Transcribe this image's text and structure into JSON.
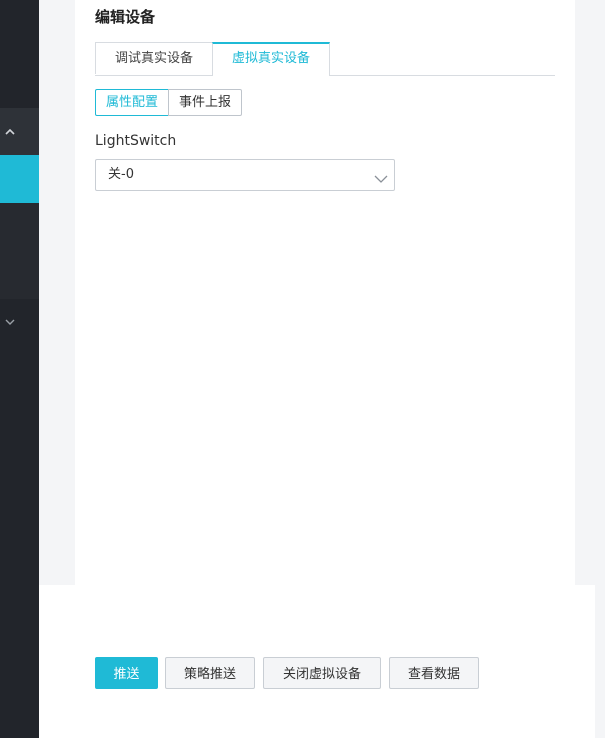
{
  "dialog": {
    "title": "编辑设备",
    "tabs": [
      {
        "label": "调试真实设备",
        "active": false
      },
      {
        "label": "虚拟真实设备",
        "active": true
      }
    ],
    "subtabs": [
      {
        "label": "属性配置",
        "active": true
      },
      {
        "label": "事件上报",
        "active": false
      }
    ],
    "property": {
      "label": "LightSwitch",
      "selected": "关-0"
    }
  },
  "actions": {
    "push": "推送",
    "strategy_push": "策略推送",
    "close_virtual": "关闭虚拟设备",
    "view_data": "查看数据"
  },
  "colors": {
    "accent": "#1fbad6",
    "sidebar": "#22252b"
  },
  "icons": {
    "sidebar_up": "chevron-up-icon",
    "sidebar_down": "chevron-down-icon",
    "select_arrow": "chevron-down-icon"
  }
}
